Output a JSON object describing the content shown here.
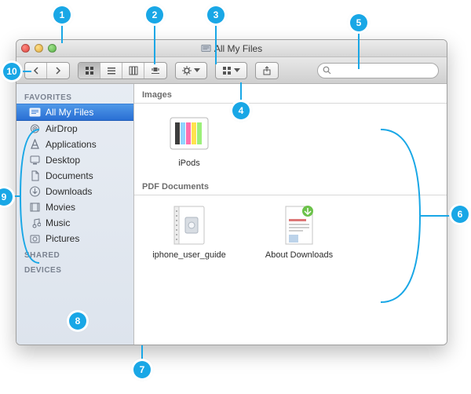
{
  "window": {
    "title": "All My Files"
  },
  "toolbar": {
    "search_placeholder": ""
  },
  "sidebar": {
    "sections": {
      "favorites": "FAVORITES",
      "shared": "SHARED",
      "devices": "DEVICES"
    },
    "items": [
      {
        "label": "All My Files",
        "icon": "all-files-icon",
        "selected": true
      },
      {
        "label": "AirDrop",
        "icon": "airdrop-icon"
      },
      {
        "label": "Applications",
        "icon": "applications-icon"
      },
      {
        "label": "Desktop",
        "icon": "desktop-icon"
      },
      {
        "label": "Documents",
        "icon": "documents-icon"
      },
      {
        "label": "Downloads",
        "icon": "downloads-icon"
      },
      {
        "label": "Movies",
        "icon": "movies-icon"
      },
      {
        "label": "Music",
        "icon": "music-icon"
      },
      {
        "label": "Pictures",
        "icon": "pictures-icon"
      }
    ]
  },
  "content": {
    "sections": [
      {
        "title": "Images",
        "items": [
          {
            "label": "iPods",
            "kind": "image"
          }
        ]
      },
      {
        "title": "PDF Documents",
        "items": [
          {
            "label": "iphone_user_guide",
            "kind": "pdf"
          },
          {
            "label": "About Downloads",
            "kind": "pdf-green"
          }
        ]
      }
    ]
  },
  "callouts": [
    "1",
    "2",
    "3",
    "4",
    "5",
    "6",
    "7",
    "8",
    "9",
    "10"
  ]
}
